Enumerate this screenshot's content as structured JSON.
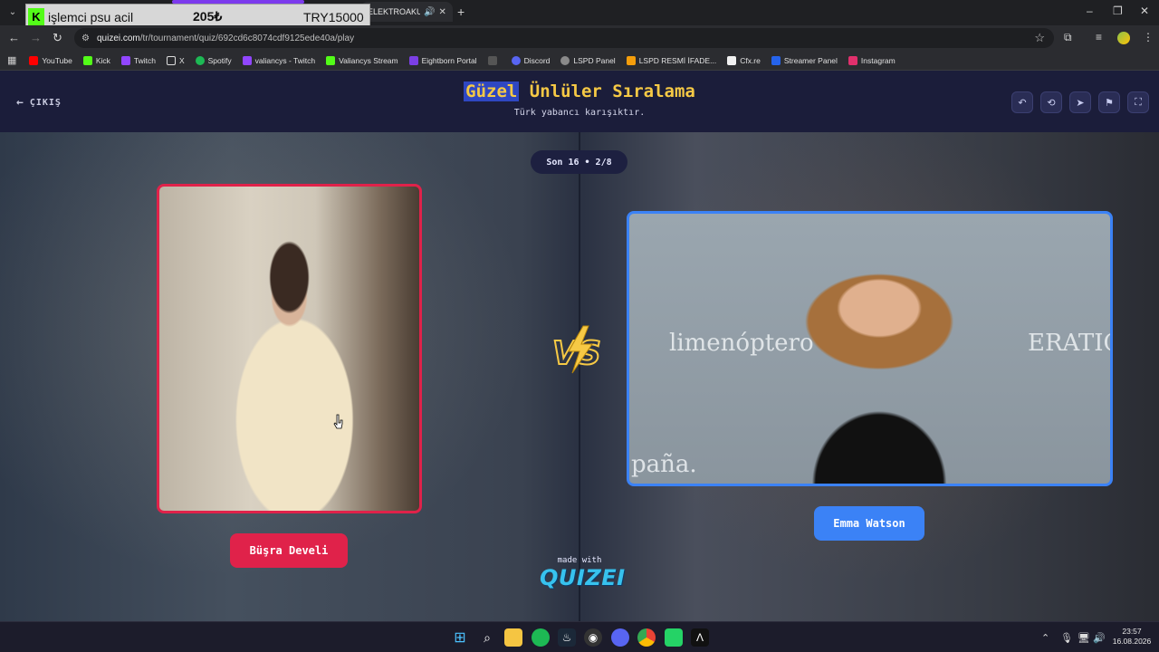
{
  "browser": {
    "overlay": {
      "badge": "K",
      "title": "işlemci psu acil",
      "price": "205₺",
      "goal": "TRY15000"
    },
    "active_tab_title": "ELEKTROAKUSTİ",
    "url_domain": "quizei.com",
    "url_path": "/tr/tournament/quiz/692cd6c8074cdf9125ede40a/play",
    "bookmarks": [
      {
        "label": "YouTube",
        "color": "#ff0000"
      },
      {
        "label": "Kick",
        "color": "#53fc18"
      },
      {
        "label": "Twitch",
        "color": "#9146ff"
      },
      {
        "label": "X",
        "color": "#ffffff"
      },
      {
        "label": "Spotify",
        "color": "#1db954"
      },
      {
        "label": "valiancys - Twitch",
        "color": "#9146ff"
      },
      {
        "label": "Valiancys Stream",
        "color": "#53fc18"
      },
      {
        "label": "Eightborn Portal",
        "color": "#7b3fe4"
      },
      {
        "label": "",
        "color": "#555555"
      },
      {
        "label": "Discord",
        "color": "#5865f2"
      },
      {
        "label": "LSPD Panel",
        "color": "#8a8a8a"
      },
      {
        "label": "LSPD  RESMİ İFADE...",
        "color": "#f59e0b"
      },
      {
        "label": "Cfx.re",
        "color": "#f0f0f0"
      },
      {
        "label": "Streamer Panel",
        "color": "#2563eb"
      },
      {
        "label": "Instagram",
        "color": "#e1306c"
      }
    ]
  },
  "page": {
    "exit_label": "ÇIKIŞ",
    "title_highlight": "Güzel",
    "title_rest": " Ünlüler Sıralama",
    "subtitle": "Türk yabancı karışıktır.",
    "round": "Son 16 • 2/8",
    "left_contestant": "Büşra Develi",
    "right_contestant": "Emma Watson",
    "right_photo_text_1": "limenóptero",
    "right_photo_text_2": "ERATIO",
    "right_photo_text_3": "paña.",
    "made_with": "made with",
    "logo": "QUIZEI",
    "accent_left": "#e0224a",
    "accent_right": "#3b82f6",
    "title_color": "#f6c945"
  },
  "taskbar": {
    "time": "23:57",
    "date": "16.08.2026"
  }
}
